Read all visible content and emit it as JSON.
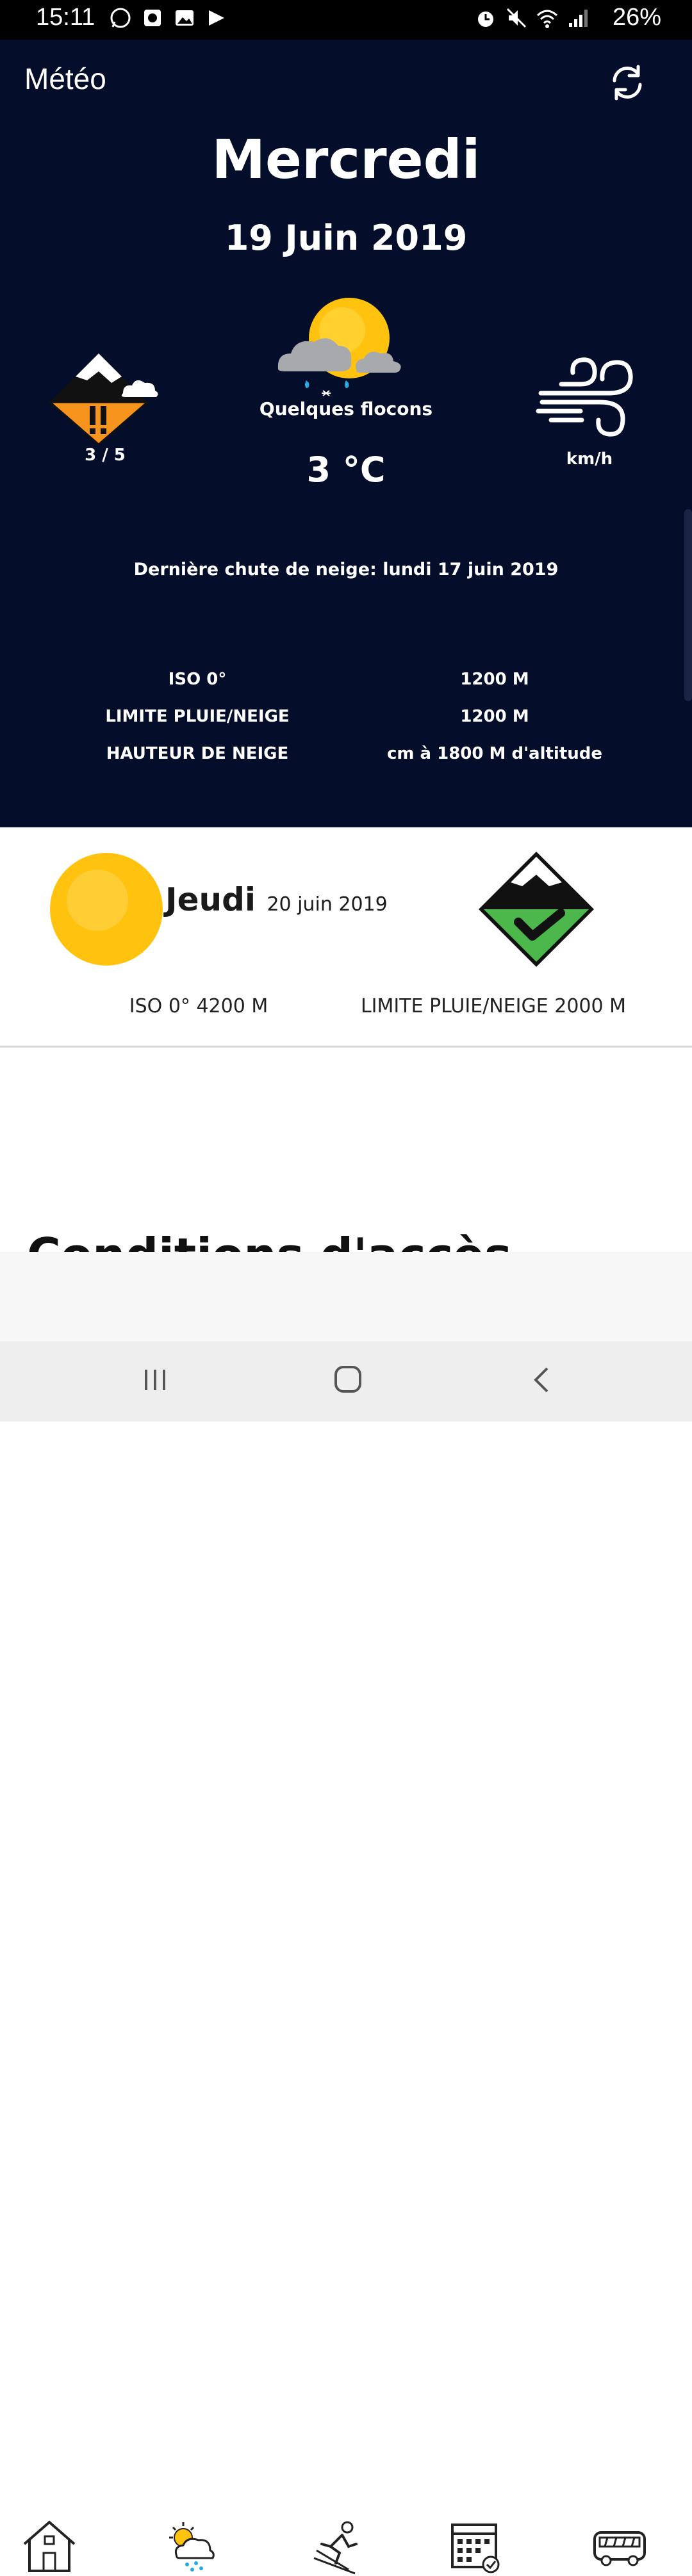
{
  "status_bar": {
    "time": "15:11",
    "battery": "26%"
  },
  "header": {
    "title": "Météo"
  },
  "today": {
    "day": "Mercredi",
    "date": "19 Juin 2019",
    "avalanche_level": "3 / 5",
    "condition": "Quelques flocons",
    "temperature": "3 °C",
    "wind_unit": "km/h",
    "last_snow": "Dernière chute de neige: lundi 17 juin 2019",
    "info_rows": [
      {
        "label": "ISO 0°",
        "value": "1200 M"
      },
      {
        "label": "LIMITE PLUIE/NEIGE",
        "value": "1200 M"
      },
      {
        "label": "HAUTEUR DE NEIGE",
        "value": "cm à 1800 M d'altitude"
      }
    ]
  },
  "tomorrow": {
    "day": "Jeudi",
    "date": "20 juin 2019",
    "iso": "ISO 0° 4200 M",
    "rain_snow_limit": "LIMITE PLUIE/NEIGE 2000 M"
  },
  "section": {
    "heading": "Conditions d'accès"
  },
  "nav": [
    "home-icon",
    "weather-icon",
    "skier-icon",
    "calendar-icon",
    "bus-icon"
  ],
  "colors": {
    "navy": "#040d2a",
    "orange": "#f7941d",
    "green": "#4cb84c",
    "sun": "#ffc20e"
  }
}
